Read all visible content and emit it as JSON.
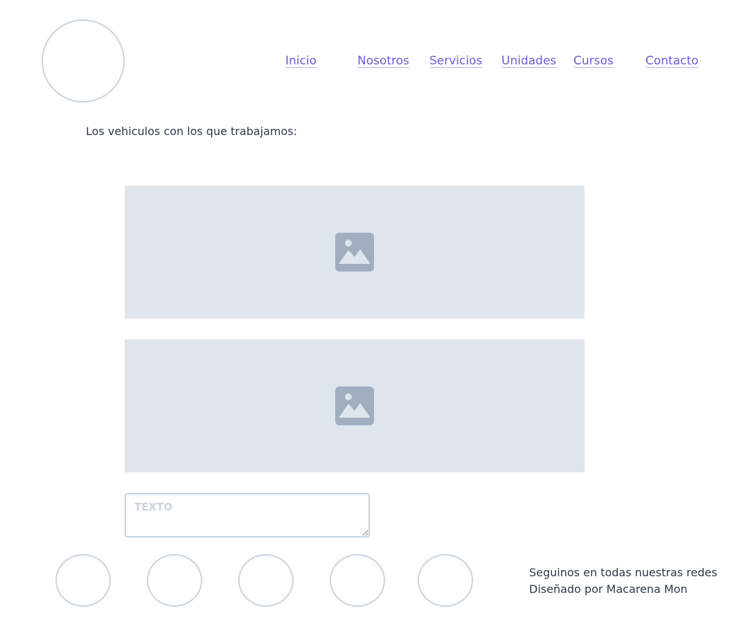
{
  "header": {
    "nav": {
      "inicio": "Inicio",
      "nosotros": "Nosotros",
      "servicios": "Servicios",
      "unidades": "Unidades",
      "cursos": "Cursos",
      "contacto": "Contacto"
    },
    "link_color": "#6b5bd6"
  },
  "main": {
    "intro": "Los vehiculos con los que trabajamos:",
    "images": [
      {
        "icon": "image-placeholder-icon"
      },
      {
        "icon": "image-placeholder-icon"
      }
    ],
    "text_field": {
      "placeholder": "TEXTO",
      "value": ""
    }
  },
  "footer": {
    "social_count": 5,
    "follow_text": "Seguinos en todas nuestras redes",
    "credit_text": "Diseñado por Macarena Mon"
  },
  "colors": {
    "placeholder_bg": "#dfe5ed",
    "icon": "#a0aec0",
    "border": "#c9d3de",
    "text": "#2d3748"
  }
}
